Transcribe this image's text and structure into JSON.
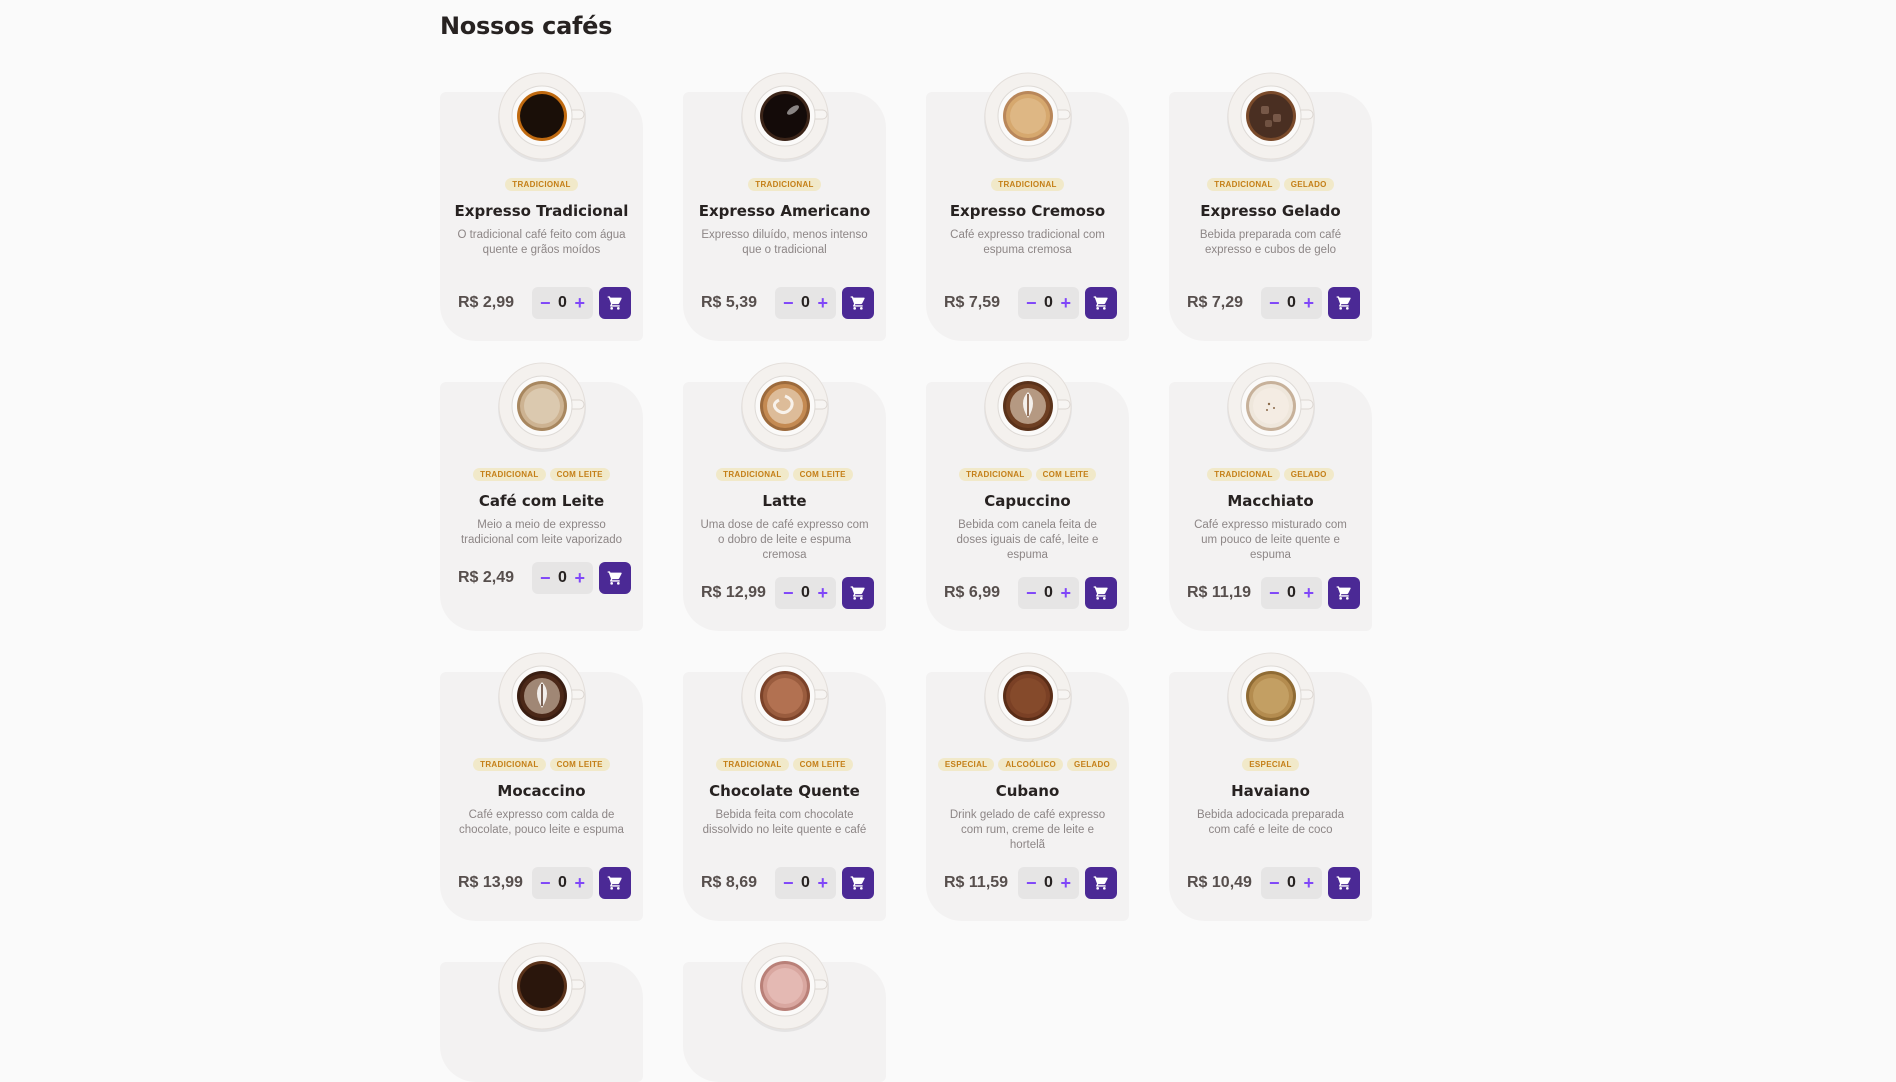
{
  "page": {
    "title": "Nossos cafés"
  },
  "theme": {
    "accent": "#8047f8",
    "cart_bg": "#4b2995",
    "tag_bg": "#f1e9c9",
    "tag_text": "#c47f17",
    "card_bg": "#f3f2f2"
  },
  "coffees": [
    {
      "name": "Expresso Tradicional",
      "tags": [
        "TRADICIONAL"
      ],
      "description": "O tradicional café feito com água quente e grãos moídos",
      "price": "R$ 2,99",
      "quantity": "0",
      "cup": "espresso-cup"
    },
    {
      "name": "Expresso Americano",
      "tags": [
        "TRADICIONAL"
      ],
      "description": "Expresso diluído, menos intenso que o tradicional",
      "price": "R$ 5,39",
      "quantity": "0",
      "cup": "americano-cup"
    },
    {
      "name": "Expresso Cremoso",
      "tags": [
        "TRADICIONAL"
      ],
      "description": "Café expresso tradicional com espuma cremosa",
      "price": "R$ 7,59",
      "quantity": "0",
      "cup": "creamy-espresso-cup"
    },
    {
      "name": "Expresso Gelado",
      "tags": [
        "TRADICIONAL",
        "GELADO"
      ],
      "description": "Bebida preparada com café expresso e cubos de gelo",
      "price": "R$ 7,29",
      "quantity": "0",
      "cup": "iced-espresso-cup"
    },
    {
      "name": "Café com Leite",
      "tags": [
        "TRADICIONAL",
        "COM LEITE"
      ],
      "description": "Meio a meio de expresso tradicional com leite vaporizado",
      "price": "R$ 2,49",
      "quantity": "0",
      "cup": "coffee-with-milk-cup"
    },
    {
      "name": "Latte",
      "tags": [
        "TRADICIONAL",
        "COM LEITE"
      ],
      "description": "Uma dose de café expresso com o dobro de leite e espuma cremosa",
      "price": "R$ 12,99",
      "quantity": "0",
      "cup": "latte-cup"
    },
    {
      "name": "Capuccino",
      "tags": [
        "TRADICIONAL",
        "COM LEITE"
      ],
      "description": "Bebida com canela feita de doses iguais de café, leite e espuma",
      "price": "R$ 6,99",
      "quantity": "0",
      "cup": "cappuccino-cup"
    },
    {
      "name": "Macchiato",
      "tags": [
        "TRADICIONAL",
        "GELADO"
      ],
      "description": "Café expresso misturado com um pouco de leite quente e espuma",
      "price": "R$ 11,19",
      "quantity": "0",
      "cup": "macchiato-cup"
    },
    {
      "name": "Mocaccino",
      "tags": [
        "TRADICIONAL",
        "COM LEITE"
      ],
      "description": "Café expresso com calda de chocolate, pouco leite e espuma",
      "price": "R$ 13,99",
      "quantity": "0",
      "cup": "mocaccino-cup"
    },
    {
      "name": "Chocolate Quente",
      "tags": [
        "TRADICIONAL",
        "COM LEITE"
      ],
      "description": "Bebida feita com chocolate dissolvido no leite quente e café",
      "price": "R$ 8,69",
      "quantity": "0",
      "cup": "hot-chocolate-cup"
    },
    {
      "name": "Cubano",
      "tags": [
        "ESPECIAL",
        "ALCOÓLICO",
        "GELADO"
      ],
      "description": "Drink gelado de café expresso com rum, creme de leite e hortelã",
      "price": "R$ 11,59",
      "quantity": "0",
      "cup": "cubano-cup"
    },
    {
      "name": "Havaiano",
      "tags": [
        "ESPECIAL"
      ],
      "description": "Bebida adocicada preparada com café e leite de coco",
      "price": "R$ 10,49",
      "quantity": "0",
      "cup": "havaiano-cup"
    }
  ]
}
